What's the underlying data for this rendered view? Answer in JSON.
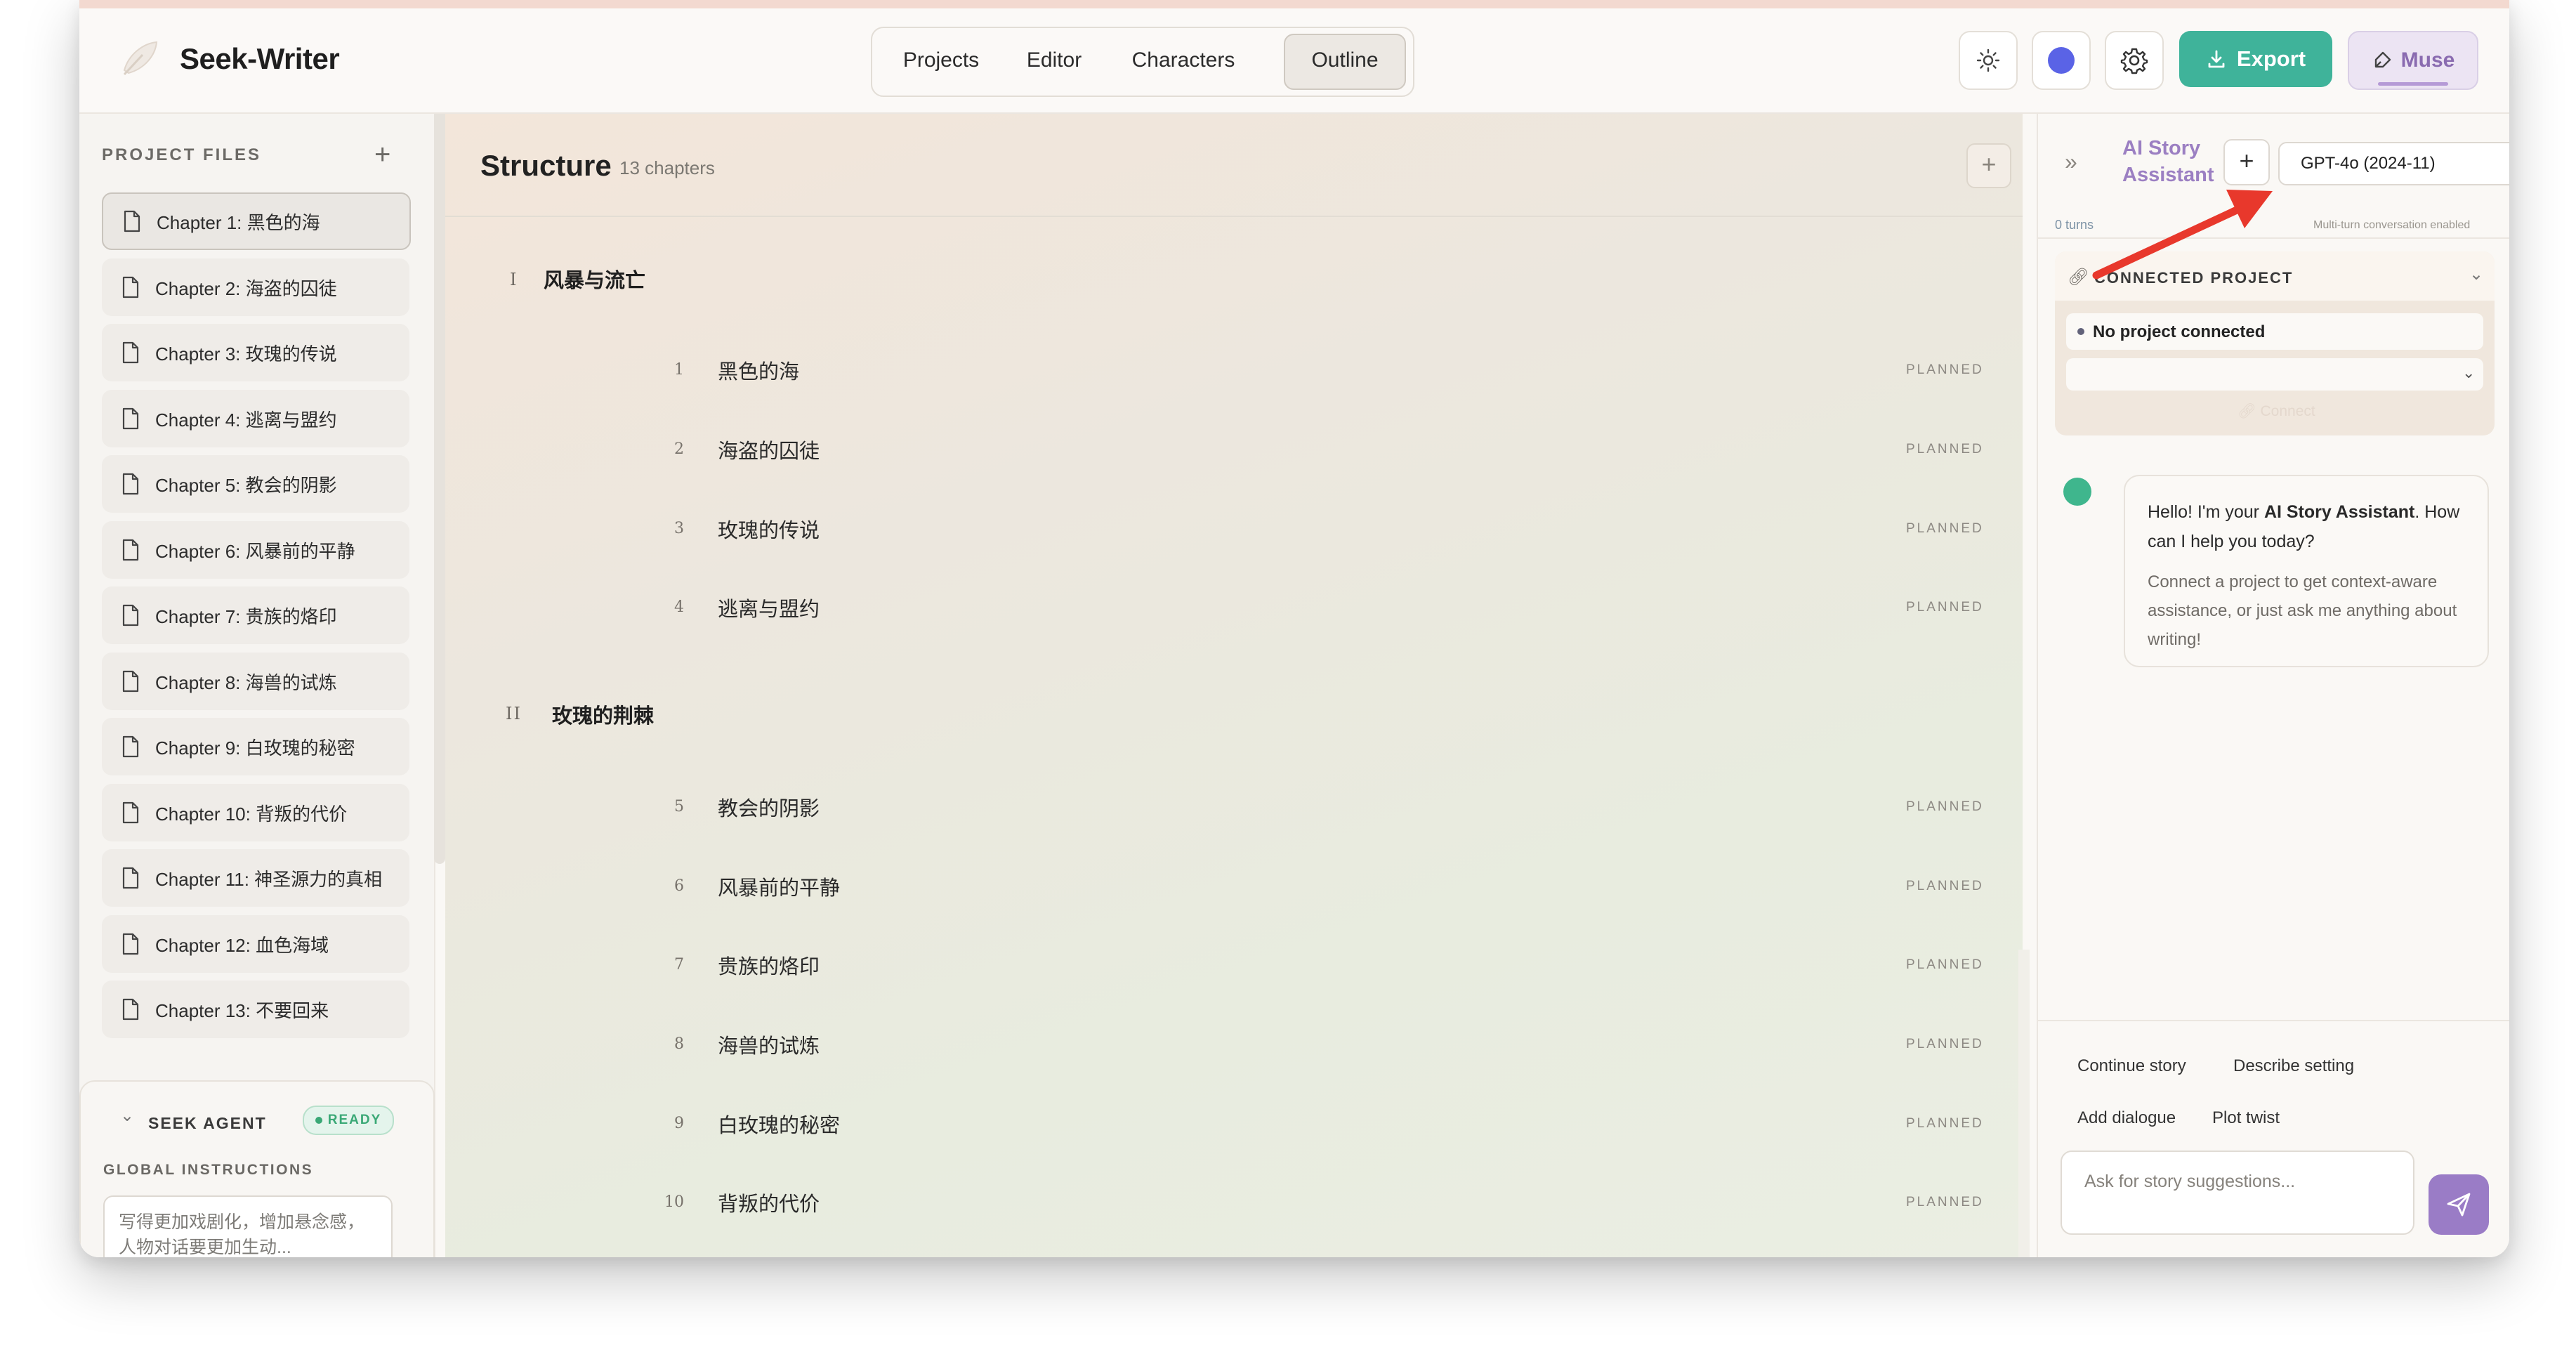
{
  "app": {
    "title": "Seek-Writer"
  },
  "nav": {
    "tabs": [
      "Projects",
      "Editor",
      "Characters",
      "Outline"
    ],
    "active": "Outline"
  },
  "header": {
    "export_label": "Export",
    "muse_label": "Muse",
    "icons": [
      "sun-icon",
      "color-dot-icon",
      "gear-icon",
      "download-icon",
      "feather-icon"
    ],
    "accent_color": "#3fb39a",
    "muse_color": "#8a6bb0"
  },
  "sidebar": {
    "label": "PROJECT FILES",
    "add_icon": "+",
    "chapters": [
      "Chapter 1: 黑色的海",
      "Chapter 2: 海盗的囚徒",
      "Chapter 3: 玫瑰的传说",
      "Chapter 4: 逃离与盟约",
      "Chapter 5: 教会的阴影",
      "Chapter 6: 风暴前的平静",
      "Chapter 7: 贵族的烙印",
      "Chapter 8: 海兽的试炼",
      "Chapter 9: 白玫瑰的秘密",
      "Chapter 10: 背叛的代价",
      "Chapter 11: 神圣源力的真相",
      "Chapter 12: 血色海域",
      "Chapter 13: 不要回来"
    ],
    "active_index": 0
  },
  "agent": {
    "title": "SEEK AGENT",
    "status": "READY",
    "instructions_label": "GLOBAL INSTRUCTIONS",
    "instructions_value": "写得更加戏剧化，增加悬念感，人物对话要更加生动..."
  },
  "outline": {
    "title": "Structure",
    "count": "13 chapters",
    "add_icon": "+",
    "parts": [
      {
        "numeral": "I",
        "title": "风暴与流亡",
        "chapters": [
          {
            "num": "1",
            "title": "黑色的海",
            "status": "PLANNED"
          },
          {
            "num": "2",
            "title": "海盗的囚徒",
            "status": "PLANNED"
          },
          {
            "num": "3",
            "title": "玫瑰的传说",
            "status": "PLANNED"
          },
          {
            "num": "4",
            "title": "逃离与盟约",
            "status": "PLANNED"
          }
        ]
      },
      {
        "numeral": "II",
        "title": "玫瑰的荆棘",
        "chapters": [
          {
            "num": "5",
            "title": "教会的阴影",
            "status": "PLANNED"
          },
          {
            "num": "6",
            "title": "风暴前的平静",
            "status": "PLANNED"
          },
          {
            "num": "7",
            "title": "贵族的烙印",
            "status": "PLANNED"
          },
          {
            "num": "8",
            "title": "海兽的试炼",
            "status": "PLANNED"
          },
          {
            "num": "9",
            "title": "白玫瑰的秘密",
            "status": "PLANNED"
          },
          {
            "num": "10",
            "title": "背叛的代价",
            "status": "PLANNED"
          }
        ]
      }
    ]
  },
  "assistant": {
    "title_line1": "AI Story",
    "title_line2": "Assistant",
    "model": "GPT-4o (2024-11)",
    "turns": "0 turns",
    "multi_turn": "Multi-turn conversation enabled",
    "connected_label": "CONNECTED PROJECT",
    "no_project": "No project connected",
    "connect_label": "Connect",
    "greeting_pre": "Hello! I'm your ",
    "greeting_bold": "AI Story Assistant",
    "greeting_post": ". How can I help you today?",
    "greeting_sub": "Connect a project to get context-aware assistance, or just ask me anything about writing!",
    "quick_actions": [
      "Continue story",
      "Describe setting",
      "Add dialogue",
      "Plot twist"
    ],
    "input_placeholder": "Ask for story suggestions..."
  }
}
